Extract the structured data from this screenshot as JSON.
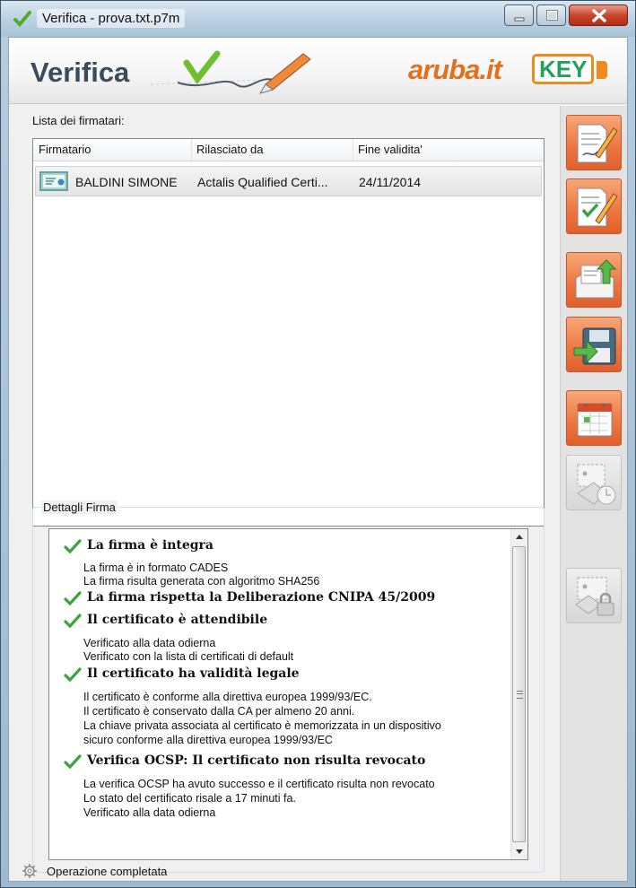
{
  "window": {
    "title": "Verifica - prova.txt.p7m"
  },
  "header": {
    "title": "Verifica",
    "brand": "aruba.it",
    "brand_key": "KEY"
  },
  "signers": {
    "label": "Lista dei firmatari:",
    "columns": [
      "Firmatario",
      "Rilasciato da",
      "Fine validita'"
    ],
    "rows": [
      {
        "signer": "BALDINI SIMONE",
        "issuer": "Actalis Qualified Certi...",
        "valid_until": "24/11/2014"
      }
    ]
  },
  "details": {
    "label": "Dettagli Firma",
    "sections": [
      {
        "title": "La firma è integra",
        "lines": [
          "La firma è in formato CADES",
          "La firma risulta generata con algoritmo SHA256"
        ]
      },
      {
        "title": "La firma rispetta la Deliberazione CNIPA 45/2009",
        "lines": []
      },
      {
        "title": "Il certificato è attendibile",
        "lines": [
          "Verificato alla data odierna",
          "Verificato con la lista di certificati di default"
        ]
      },
      {
        "title": "Il certificato ha validità legale",
        "lines": [
          "Il certificato è conforme alla direttiva europea 1999/93/EC.",
          "Il certificato è conservato dalla CA per almeno 20 anni.",
          "La chiave privata associata al certificato è memorizzata in un dispositivo",
          "sicuro conforme alla direttiva europea 1999/93/EC"
        ]
      },
      {
        "title": "Verifica OCSP: Il certificato non risulta revocato",
        "lines": [
          "La verifica OCSP ha avuto successo e il certificato risulta non revocato",
          "Lo stato del certificato risale a 17 minuti fa.",
          "Verificato alla data odierna"
        ]
      }
    ]
  },
  "sidebar": {
    "buttons": [
      {
        "icon": "sign-document-icon",
        "enabled": true
      },
      {
        "icon": "verify-signature-icon",
        "enabled": true
      },
      {
        "icon": "open-document-icon",
        "enabled": true
      },
      {
        "icon": "save-document-icon",
        "enabled": true
      },
      {
        "icon": "calendar-icon",
        "enabled": true
      },
      {
        "icon": "timestamp-icon",
        "enabled": false
      },
      {
        "icon": "encrypt-icon",
        "enabled": false
      }
    ]
  },
  "status": {
    "text": "Operazione completata"
  },
  "colors": {
    "accent_orange": "#ed7440",
    "check_green": "#3aa33a",
    "brand_orange": "#e4701e",
    "brand_green": "#23a15a"
  }
}
